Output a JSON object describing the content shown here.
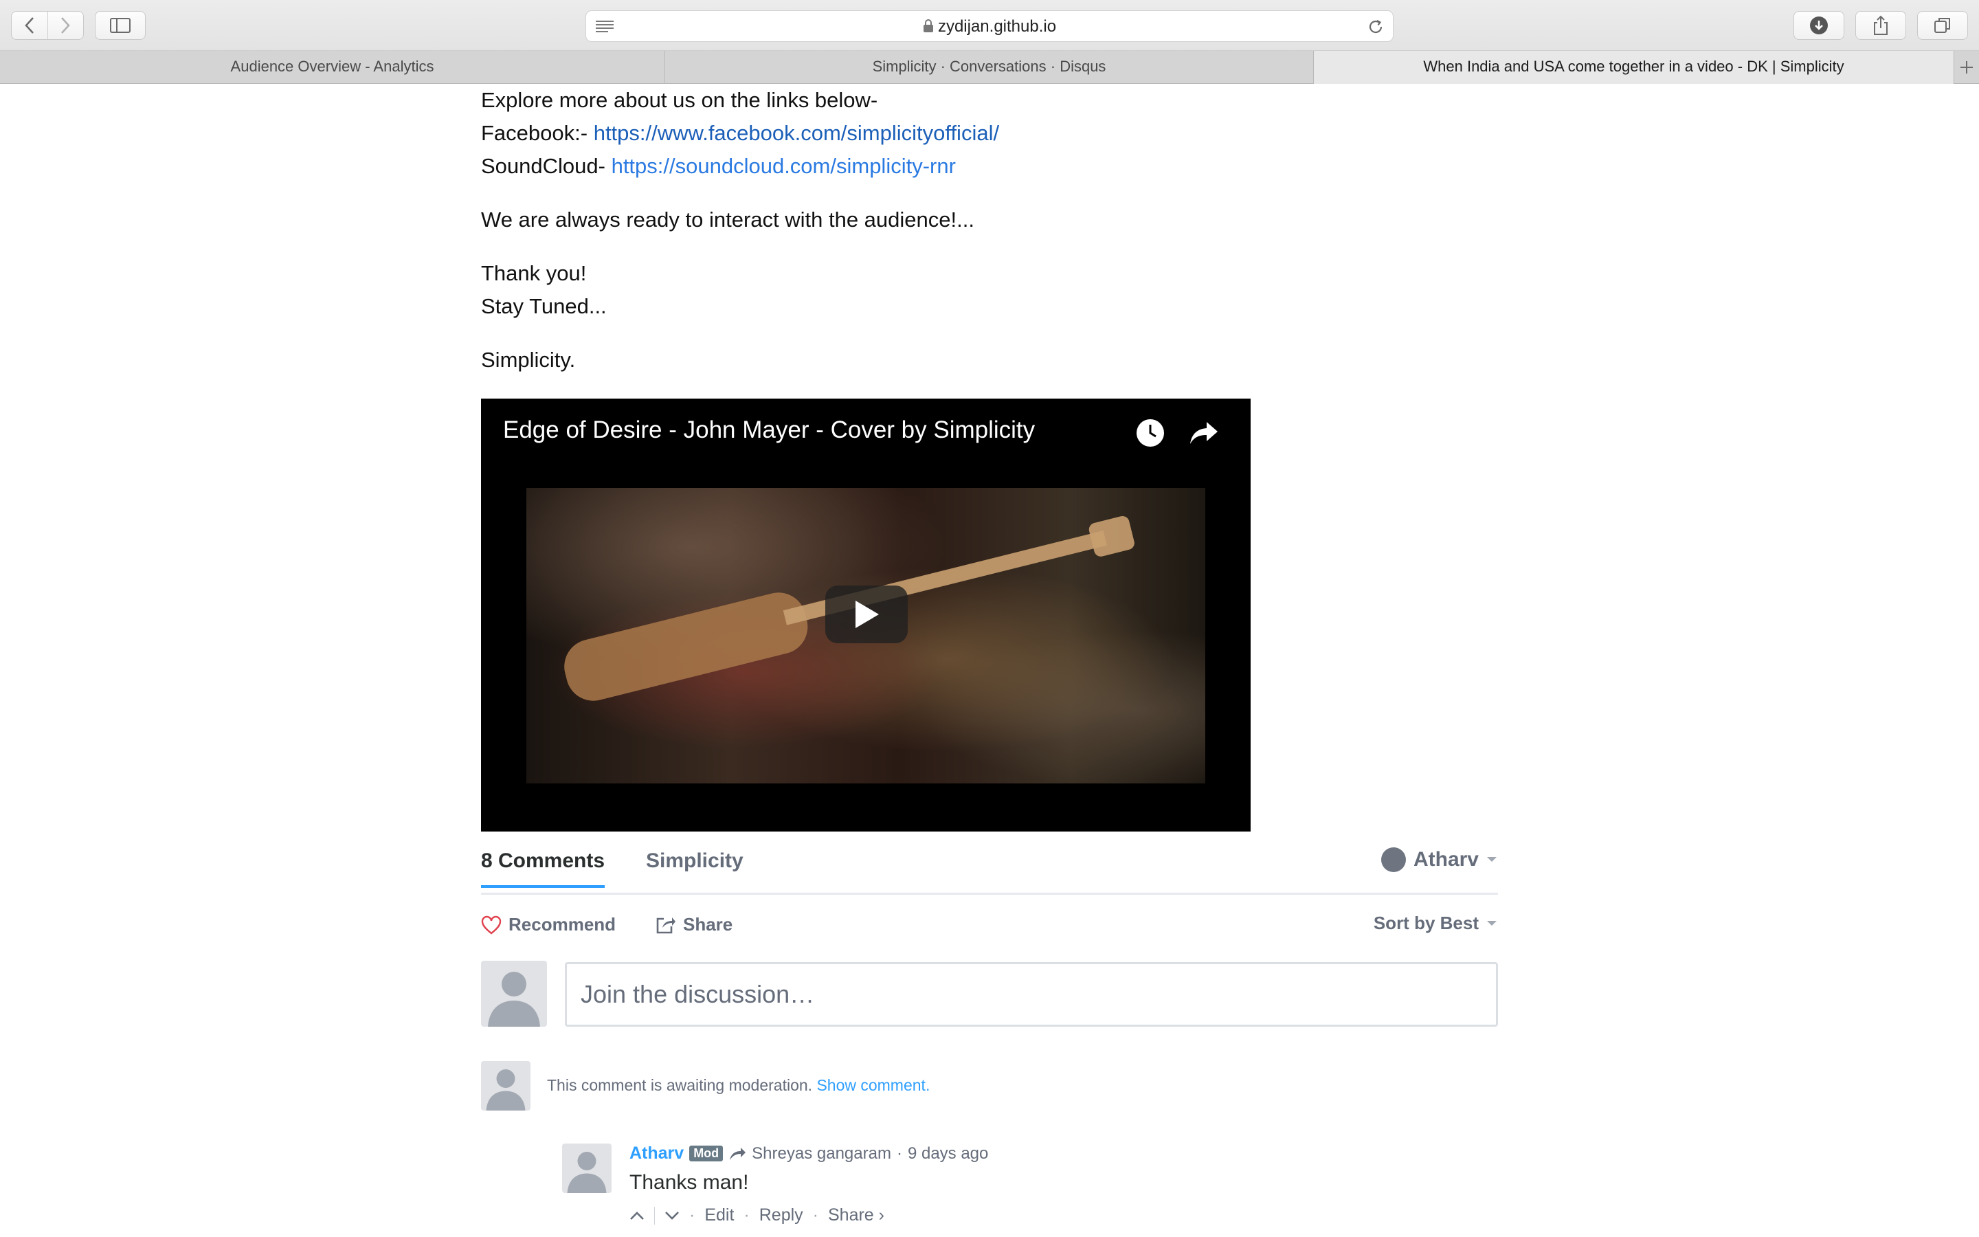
{
  "browser": {
    "url": "zydijan.github.io",
    "tabs": [
      {
        "title": "Audience Overview - Analytics"
      },
      {
        "title": "Simplicity · Conversations · Disqus"
      },
      {
        "title": "When India and USA come together in a video - DK | Simplicity"
      }
    ],
    "icons": [
      "back-icon",
      "forward-icon",
      "sidebar-icon",
      "reader-icon",
      "lock-icon",
      "reload-icon",
      "download-icon",
      "share-icon",
      "tabs-icon",
      "new-tab-icon"
    ]
  },
  "article": {
    "explore": "Explore more about us on the links below-",
    "facebook_label": "Facebook:- ",
    "facebook_url": "https://www.facebook.com/simplicityofficial/",
    "soundcloud_label": "SoundCloud- ",
    "soundcloud_url": "https://soundcloud.com/simplicity-rnr",
    "interact": "We are always ready to interact with the audience!...",
    "thanks": "Thank you!",
    "stay": "Stay Tuned...",
    "signoff": "Simplicity."
  },
  "video": {
    "title": "Edge of Desire - John Mayer - Cover by Simplicity",
    "icons": [
      "watch-later-icon",
      "share-arrow-icon",
      "play-icon"
    ]
  },
  "disqus": {
    "comment_count": "8 Comments",
    "forum_name": "Simplicity",
    "user_name": "Atharv",
    "recommend_label": "Recommend",
    "share_label": "Share",
    "sort_label": "Sort by Best",
    "compose_placeholder": "Join the discussion…",
    "moderation_text": "This comment is awaiting moderation. ",
    "show_comment": "Show comment.",
    "reply": {
      "author": "Atharv",
      "badge": "Mod",
      "in_reply_to": "Shreyas gangaram",
      "time": "9 days ago",
      "body": "Thanks man!",
      "edit": "Edit",
      "reply": "Reply",
      "share": "Share ›"
    },
    "accent_color": "#2e9fff"
  }
}
